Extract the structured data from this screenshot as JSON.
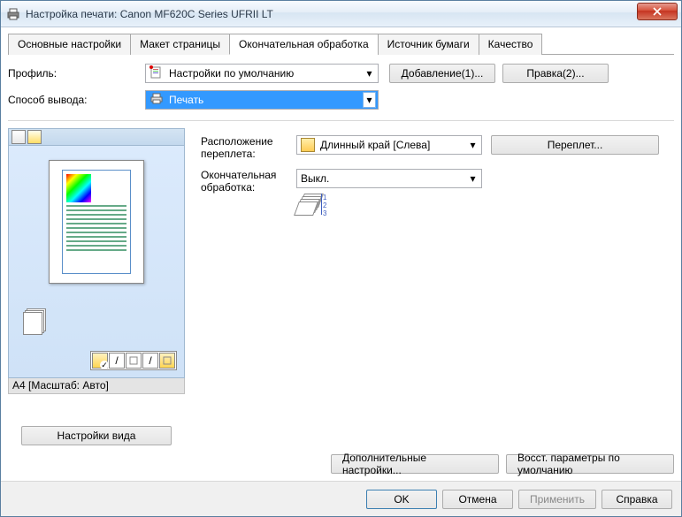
{
  "window": {
    "title": "Настройка печати: Canon MF620C Series UFRII LT"
  },
  "tabs": {
    "basic": "Основные настройки",
    "layout": "Макет страницы",
    "finishing": "Окончательная обработка",
    "source": "Источник бумаги",
    "quality": "Качество"
  },
  "profile": {
    "label": "Профиль:",
    "value": "Настройки по умолчанию",
    "add_btn": "Добавление(1)...",
    "edit_btn": "Правка(2)..."
  },
  "output": {
    "label": "Способ вывода:",
    "value": "Печать"
  },
  "preview": {
    "status": "A4 [Масштаб: Авто]",
    "view_btn": "Настройки вида"
  },
  "binding": {
    "label": "Расположение переплета:",
    "value": "Длинный край [Слева]",
    "btn": "Переплет..."
  },
  "finishing": {
    "label": "Окончательная обработка:",
    "value": "Выкл."
  },
  "bottom": {
    "advanced": "Дополнительные настройки...",
    "restore": "Восст. параметры по умолчанию"
  },
  "footer": {
    "ok": "OK",
    "cancel": "Отмена",
    "apply": "Применить",
    "help": "Справка"
  }
}
